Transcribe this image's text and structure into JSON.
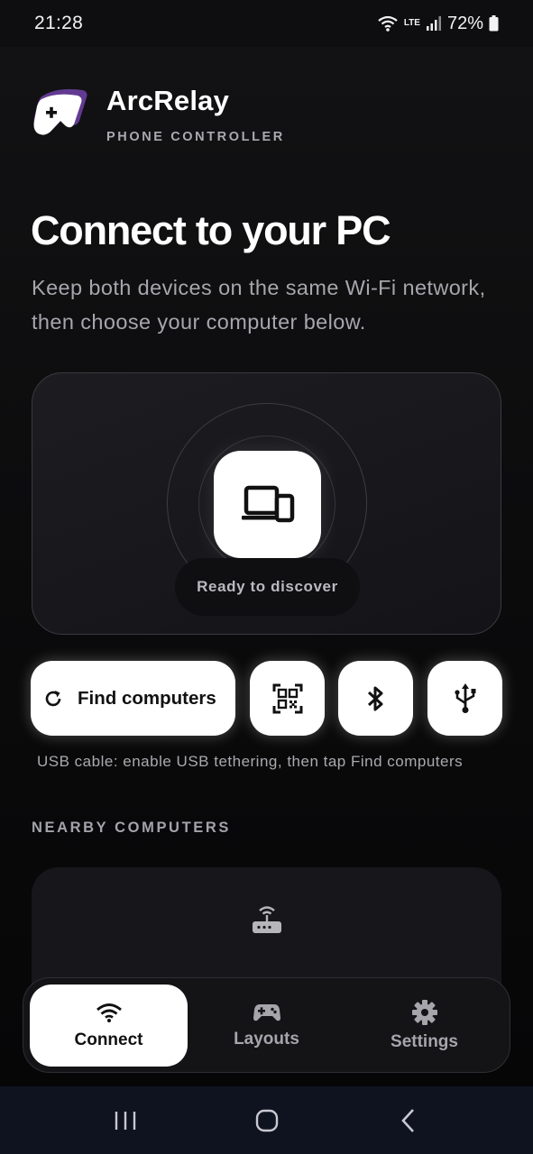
{
  "status_bar": {
    "time": "21:28",
    "network": "LTE",
    "battery": "72%"
  },
  "brand": {
    "name": "ArcRelay",
    "subtitle": "PHONE CONTROLLER",
    "logo_icon": "gamepad-logo-icon"
  },
  "main": {
    "headline": "Connect to your PC",
    "description": "Keep both devices on the same Wi-Fi network, then choose your computer below."
  },
  "discover": {
    "device_icon": "devices-icon",
    "status": "Ready to discover"
  },
  "actions": {
    "find_label": "Find computers",
    "find_icon": "refresh-icon",
    "qr_icon": "qr-code-scan-icon",
    "bluetooth_icon": "bluetooth-icon",
    "usb_icon": "usb-icon"
  },
  "usb_hint": "USB cable: enable USB tethering, then tap Find computers",
  "nearby": {
    "label": "NEARBY COMPUTERS",
    "empty_icon": "router-icon"
  },
  "bottom_nav": {
    "items": [
      {
        "label": "Connect",
        "icon": "wifi-icon",
        "active": true
      },
      {
        "label": "Layouts",
        "icon": "gamepad-icon",
        "active": false
      },
      {
        "label": "Settings",
        "icon": "gear-icon",
        "active": false
      }
    ]
  },
  "system_nav": {
    "recents": "recents-icon",
    "home": "home-icon",
    "back": "back-icon"
  },
  "colors": {
    "background": "#0a0a0b",
    "card": "#17171b",
    "accent_purple": "#7b4bb3",
    "white": "#ffffff"
  }
}
